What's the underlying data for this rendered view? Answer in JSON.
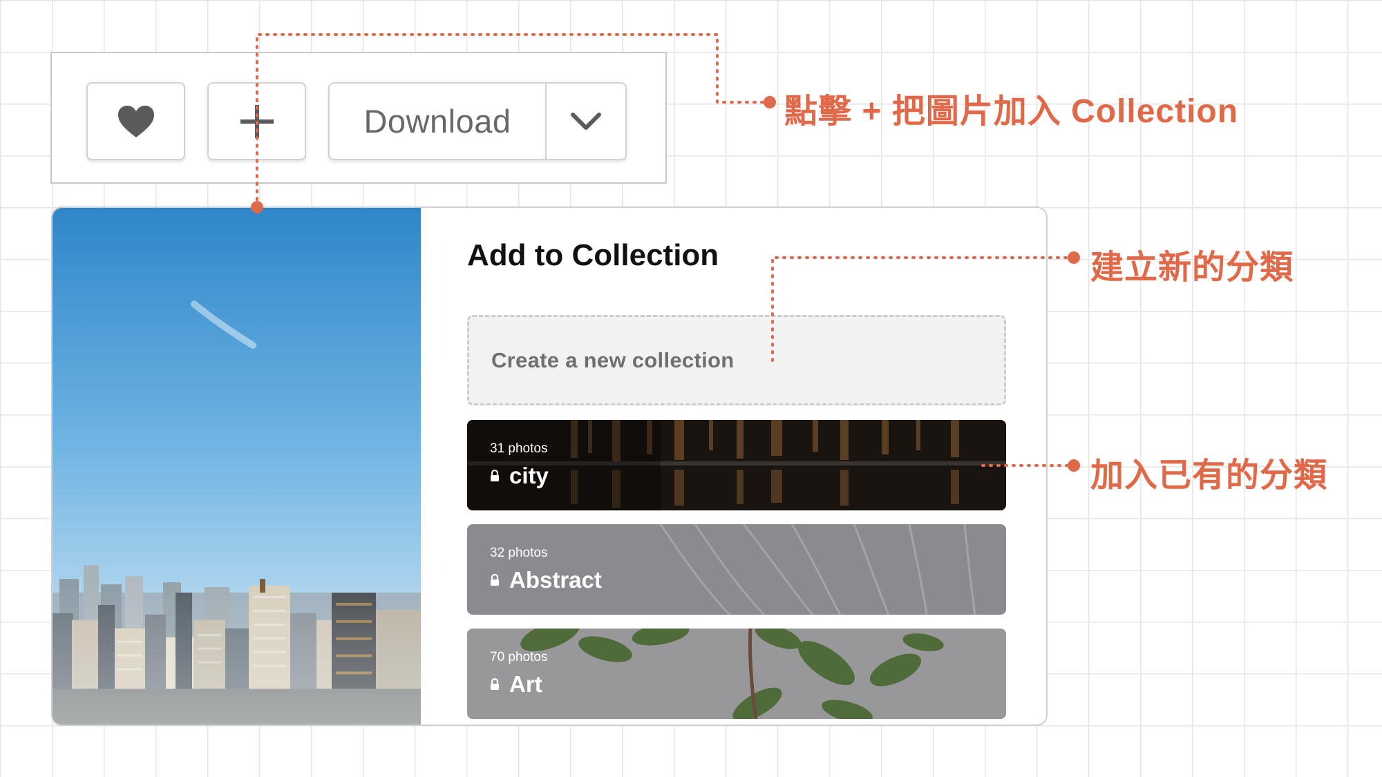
{
  "toolbar": {
    "like_icon": "heart-icon",
    "add_icon": "plus-icon",
    "download_label": "Download",
    "download_menu_icon": "chevron-down-icon"
  },
  "panel": {
    "title": "Add to Collection",
    "new_collection_placeholder": "Create a new collection",
    "collections": [
      {
        "count": "31 photos",
        "name": "city",
        "icon": "lock-icon"
      },
      {
        "count": "32 photos",
        "name": "Abstract",
        "icon": "lock-icon"
      },
      {
        "count": "70 photos",
        "name": "Art",
        "icon": "lock-icon"
      }
    ]
  },
  "annotations": {
    "add_to_collection": "點擊 + 把圖片加入 Collection",
    "create_new": "建立新的分類",
    "add_existing": "加入已有的分類"
  },
  "colors": {
    "accent": "#e0694a",
    "city_bg": "#1a1410",
    "abstract_bg": "#8a8b8e",
    "art_bg": "#98989a"
  }
}
